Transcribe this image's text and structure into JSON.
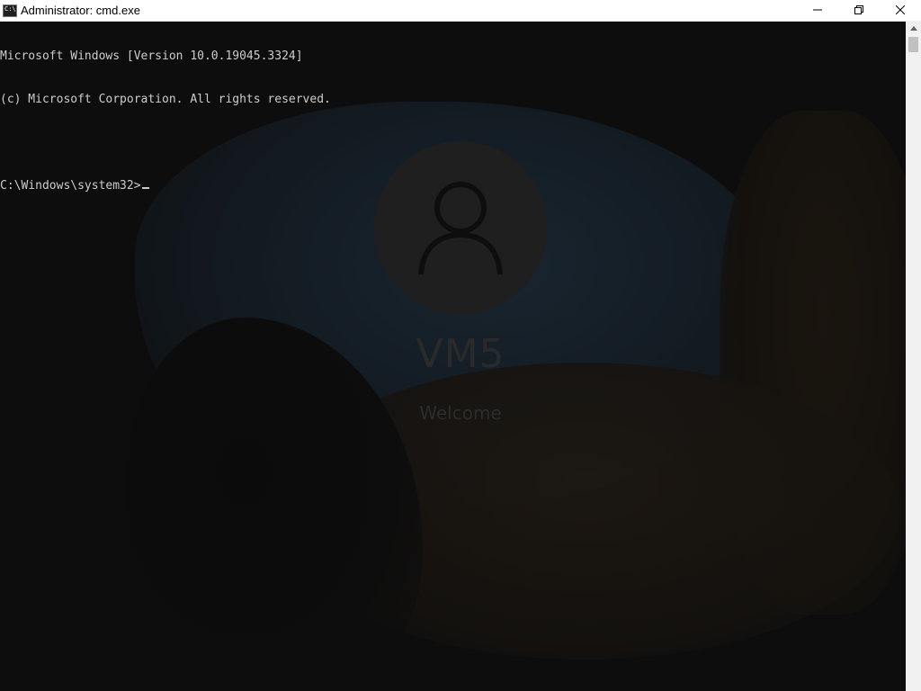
{
  "window": {
    "title": "Administrator: cmd.exe",
    "icon": "cmd-app-icon",
    "icon_text": "C:\\",
    "controls": {
      "minimize": "minimize-icon",
      "maximize": "restore-icon",
      "close": "close-icon"
    }
  },
  "console": {
    "lines": [
      "Microsoft Windows [Version 10.0.19045.3324]",
      "(c) Microsoft Corporation. All rights reserved.",
      "",
      "C:\\Windows\\system32>"
    ],
    "text_color": "#cccccc",
    "background": "#0c0c0c"
  },
  "lock_screen": {
    "user_name": "VM5",
    "status": "Welcome",
    "avatar_icon": "user-avatar-icon"
  },
  "scrollbar": {
    "up_icon": "scroll-up-arrow-icon"
  }
}
